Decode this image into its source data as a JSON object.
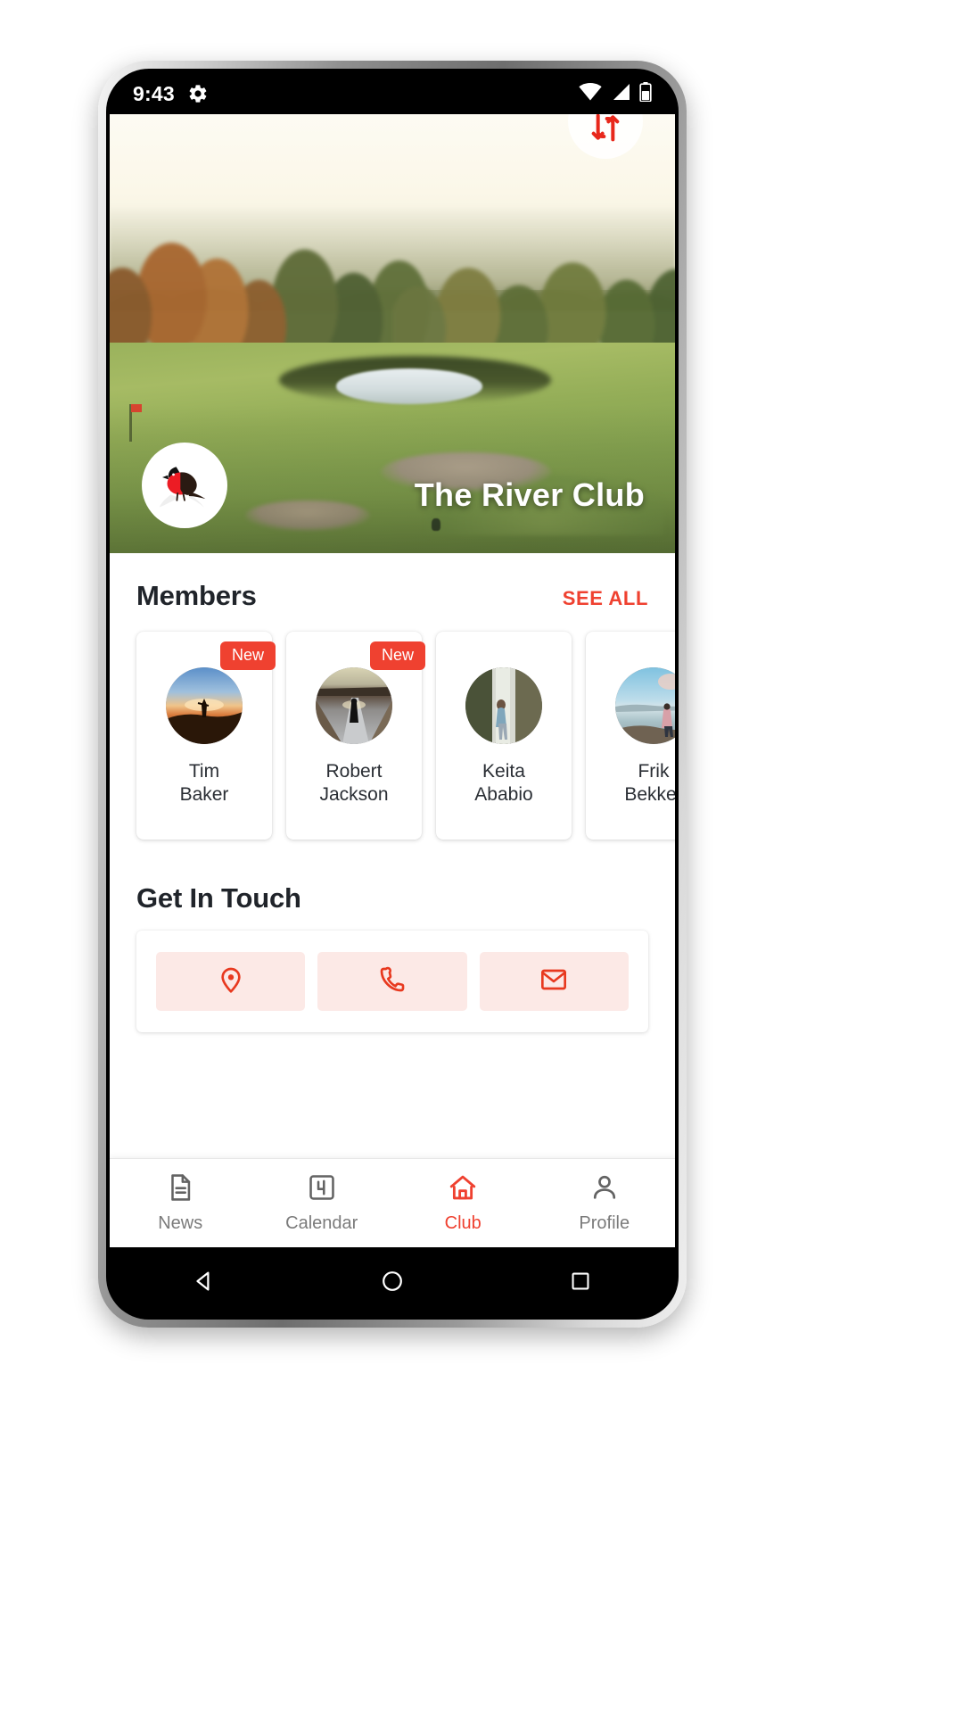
{
  "status_bar": {
    "time": "9:43",
    "icons": [
      "gear-icon",
      "wifi-icon",
      "cellular-signal-icon",
      "battery-icon"
    ]
  },
  "hero": {
    "club_title": "The River Club",
    "logo_alt": "red-bishop-bird-logo",
    "swap_button_icon": "swap-vertical-arrows-icon",
    "image_description": "golf course fairway at golden hour with autumn trees and pond"
  },
  "members_section": {
    "title": "Members",
    "see_all_label": "SEE ALL",
    "badge_label": "New",
    "members": [
      {
        "first_name": "Tim",
        "last_name": "Baker",
        "is_new": true,
        "avatar": "sunset-hiker-avatar"
      },
      {
        "first_name": "Robert",
        "last_name": "Jackson",
        "is_new": true,
        "avatar": "road-walker-avatar"
      },
      {
        "first_name": "Keita",
        "last_name": "Ababio",
        "is_new": false,
        "avatar": "waterfall-avatar"
      },
      {
        "first_name": "Frik",
        "last_name": "Bekker",
        "is_new": false,
        "avatar": "lakeside-avatar"
      }
    ]
  },
  "get_in_touch": {
    "title": "Get In Touch",
    "actions": [
      {
        "name": "location",
        "icon": "map-pin-icon"
      },
      {
        "name": "phone",
        "icon": "phone-icon"
      },
      {
        "name": "email",
        "icon": "envelope-icon"
      }
    ]
  },
  "bottom_nav": {
    "items": [
      {
        "label": "News",
        "icon": "document-icon",
        "active": false
      },
      {
        "label": "Calendar",
        "icon": "calendar-4-icon",
        "active": false
      },
      {
        "label": "Club",
        "icon": "home-icon",
        "active": true
      },
      {
        "label": "Profile",
        "icon": "person-icon",
        "active": false
      }
    ]
  },
  "android_nav": {
    "keys": [
      "back-triangle-icon",
      "home-circle-icon",
      "recents-square-icon"
    ]
  },
  "colors": {
    "accent_red": "#ef4130",
    "accent_red_soft": "#fce9e6",
    "nav_inactive": "#7b7b7b",
    "text_primary": "#20242a"
  }
}
